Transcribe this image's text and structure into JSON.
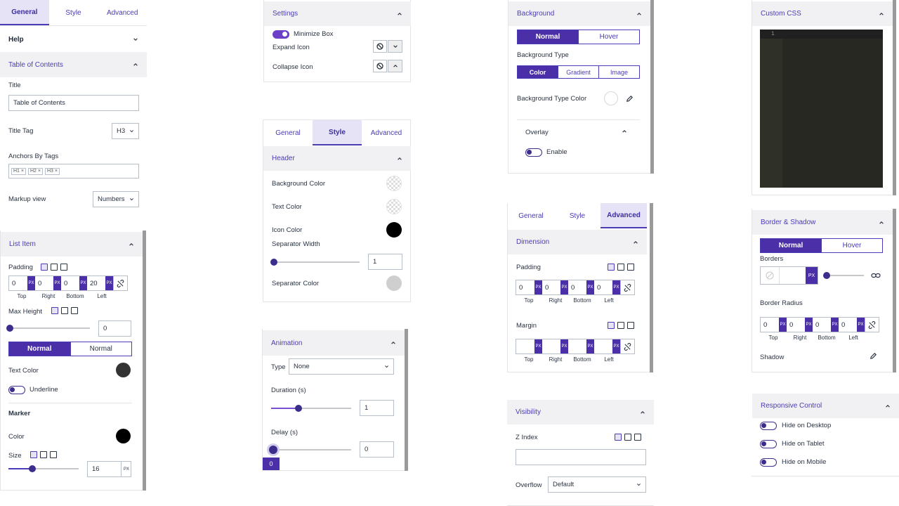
{
  "col1": {
    "tabs": [
      "General",
      "Style",
      "Advanced"
    ],
    "help": "Help",
    "toc_section": "Table of Contents",
    "title_label": "Title",
    "title_value": "Table of Contents",
    "title_tag_label": "Title Tag",
    "title_tag_value": "H3",
    "anchors_label": "Anchors By Tags",
    "anchors_tags": [
      "H1",
      "H2",
      "H3"
    ],
    "markup_label": "Markup view",
    "markup_value": "Numbers",
    "list_item_section": "List Item",
    "padding_label": "Padding",
    "padding_values": [
      "0",
      "0",
      "0",
      "20"
    ],
    "dim_labels": [
      "Top",
      "Right",
      "Bottom",
      "Left"
    ],
    "unit": "PX",
    "max_height_label": "Max Height",
    "max_height_value": "0",
    "state_tabs": [
      "Normal",
      "Normal"
    ],
    "text_color_label": "Text Color",
    "underline_label": "Underline",
    "marker_label": "Marker",
    "color_label": "Color",
    "size_label": "Size",
    "size_value": "16"
  },
  "col2": {
    "settings_section": "Settings",
    "minimize_label": "Minimize Box",
    "expand_label": "Expand Icon",
    "collapse_label": "Collapse Icon",
    "tabs": [
      "General",
      "Style",
      "Advanced"
    ],
    "header_section": "Header",
    "bg_color_label": "Background Color",
    "text_color_label": "Text Color",
    "icon_color_label": "Icon Color",
    "sep_width_label": "Separator Width",
    "sep_width_value": "1",
    "sep_color_label": "Separator Color",
    "animation_section": "Animation",
    "type_label": "Type",
    "type_value": "None",
    "duration_label": "Duration (s)",
    "duration_value": "1",
    "delay_label": "Delay (s)",
    "delay_value": "0",
    "delay_badge": "0"
  },
  "col3": {
    "background_section": "Background",
    "state_tabs": [
      "Normal",
      "Hover"
    ],
    "bg_type_label": "Background Type",
    "bg_types": [
      "Color",
      "Gradient",
      "Image"
    ],
    "bg_type_color_label": "Background Type Color",
    "overlay_label": "Overlay",
    "enable_label": "Enable",
    "tabs": [
      "General",
      "Style",
      "Advanced"
    ],
    "dimension_section": "Dimension",
    "padding_label": "Padding",
    "padding_values": [
      "0",
      "0",
      "0",
      "0"
    ],
    "margin_label": "Margin",
    "dim_labels": [
      "Top",
      "Right",
      "Bottom",
      "Left"
    ],
    "unit": "PX",
    "visibility_section": "Visibility",
    "zindex_label": "Z Index",
    "overflow_label": "Overflow",
    "overflow_value": "Default"
  },
  "col4": {
    "css_section": "Custom CSS",
    "line_number": "1",
    "border_section": "Border & Shadow",
    "state_tabs": [
      "Normal",
      "Hover"
    ],
    "borders_label": "Borders",
    "unit": "PX",
    "radius_label": "Border Radius",
    "radius_values": [
      "0",
      "0",
      "0",
      "0"
    ],
    "dim_labels": [
      "Top",
      "Right",
      "Bottom",
      "Left"
    ],
    "shadow_label": "Shadow",
    "responsive_section": "Responsive Control",
    "hide_desktop": "Hide on Desktop",
    "hide_tablet": "Hide on Tablet",
    "hide_mobile": "Hide on Mobile"
  },
  "colors": {
    "accent": "#4a2fa8",
    "link": "#4a3cb6",
    "panel_header": "#f1f1f3",
    "editor_bg": "#272822"
  }
}
